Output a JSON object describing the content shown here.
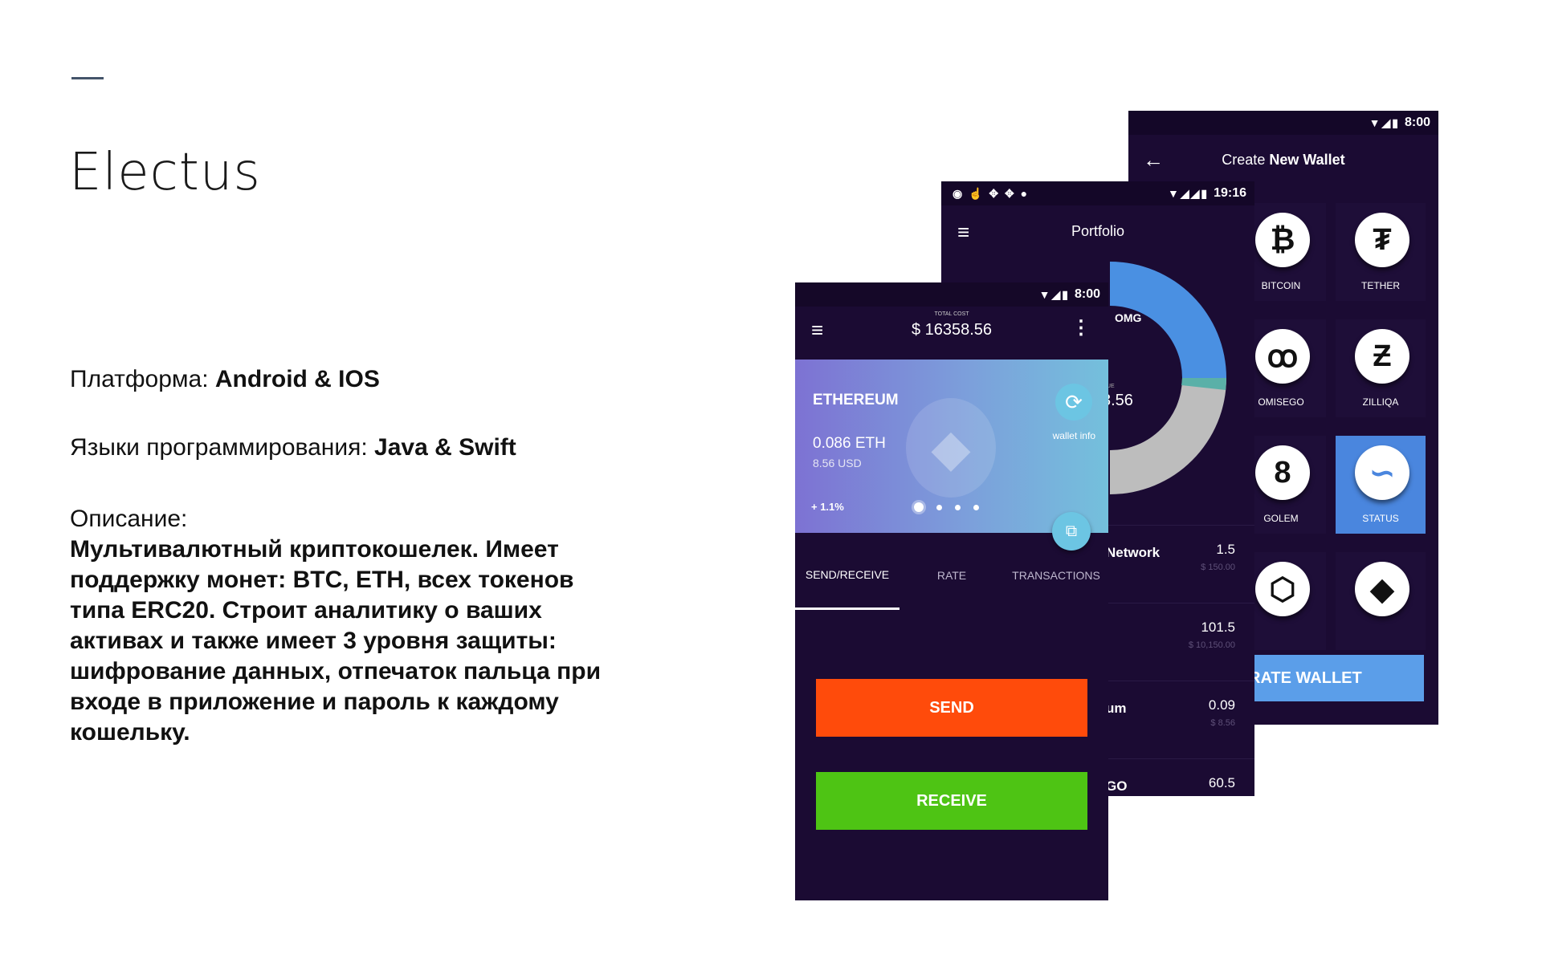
{
  "slide": {
    "title": "Electus",
    "platform_label": "Платформа: ",
    "platform_value": "Android & IOS",
    "langs_label": "Языки программирования: ",
    "langs_value": "Java & Swift",
    "desc_label": "Описание:",
    "desc_body": "Мультивалютный криптокошелек. Имеет поддержку монет: BTC, ETH, всех токенов типа ERC20. Строит аналитику о ваших активах и также имеет 3 уровня защиты: шифрование данных, отпечаток пальца при входе в приложение и пароль к каждому кошельку."
  },
  "phone_create": {
    "time": "8:00",
    "title_lite": "Create ",
    "title_strong": "New Wallet",
    "coins": [
      {
        "label": "BITCOIN",
        "icon": "bitcoin-icon",
        "glyph": "₿"
      },
      {
        "label": "TETHER",
        "icon": "tether-icon",
        "glyph": "₮"
      },
      {
        "label": "OMISEGO",
        "icon": "omisego-icon",
        "glyph": "ꝏ"
      },
      {
        "label": "ZILLIQA",
        "icon": "zilliqa-icon",
        "glyph": "Ƶ"
      },
      {
        "label": "GOLEM",
        "icon": "golem-icon",
        "glyph": "8"
      },
      {
        "label": "STATUS",
        "icon": "status-icon",
        "glyph": "∽"
      },
      {
        "label": "",
        "icon": "crypto-com-icon",
        "glyph": "⬡"
      },
      {
        "label": "",
        "icon": "kyber-icon",
        "glyph": "◆"
      }
    ],
    "button_label": "RATE WALLET"
  },
  "phone_portfolio": {
    "time": "19:16",
    "title": "Portfolio",
    "chart_label": "OMG",
    "center_label": "LUE",
    "center_value": "3.56",
    "rows": [
      {
        "name": "Network",
        "amount": "1.5",
        "usd": "$ 150.00"
      },
      {
        "name": "",
        "amount": "101.5",
        "usd": "$ 10,150.00"
      },
      {
        "name": "um",
        "amount": "0.09",
        "usd": "$ 8.56"
      },
      {
        "name": "GO",
        "amount": "60.5",
        "usd": ""
      }
    ],
    "colors": {
      "blue": "#4a90e2",
      "gray": "#bdbdbd"
    }
  },
  "phone_wallet": {
    "time": "8:00",
    "total_label": "TOTAL COST",
    "total_value": "$ 16358.56",
    "coin_name": "ETHEREUM",
    "balance": "0.086 ETH",
    "usd": "8.56  USD",
    "change": "+ 1.1%",
    "wallet_info": "wallet info",
    "tabs": [
      "SEND/RECEIVE",
      "RATE",
      "TRANSACTIONS"
    ],
    "send_label": "SEND",
    "receive_label": "RECEIVE"
  }
}
